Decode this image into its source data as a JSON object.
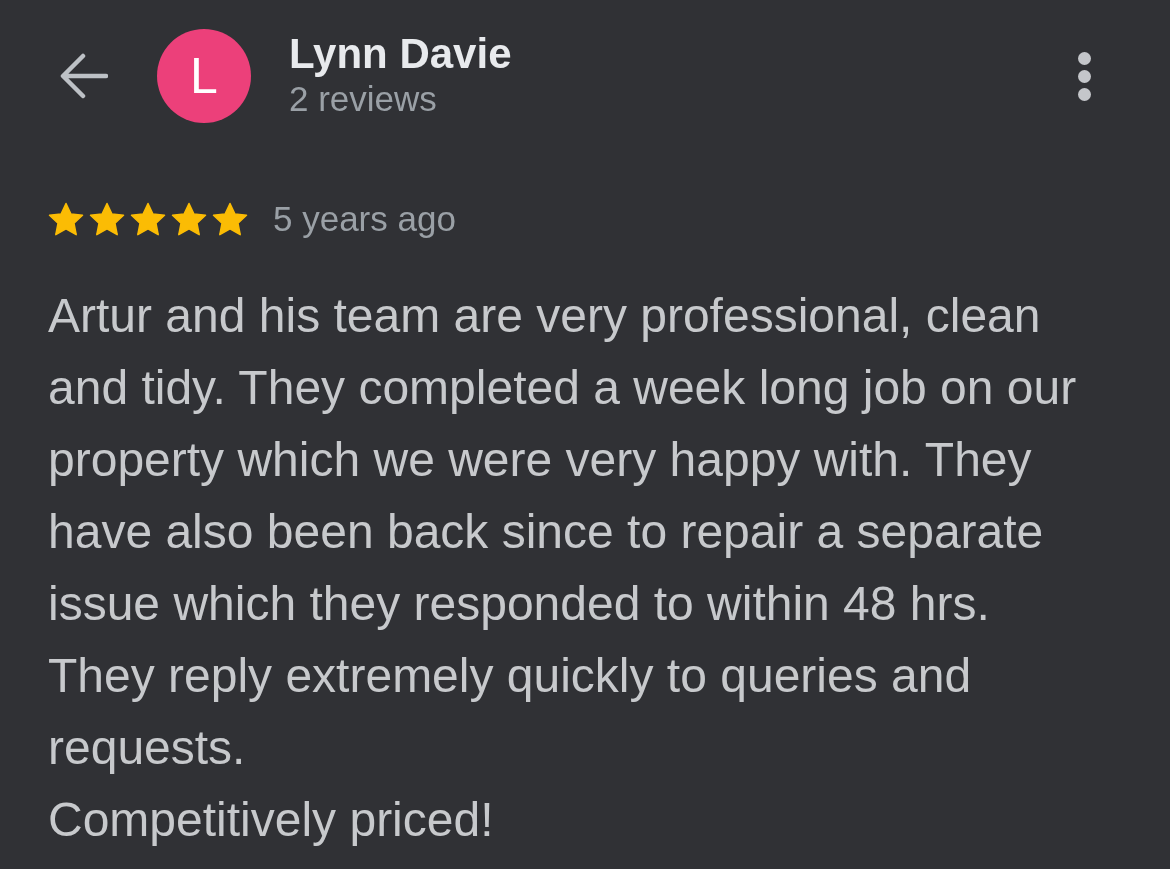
{
  "reviewer": {
    "avatar_letter": "L",
    "name": "Lynn Davie",
    "review_count": "2 reviews"
  },
  "review": {
    "stars": 5,
    "time": "5 years ago",
    "text": "Artur and his team are very professional, clean and tidy. They completed a week long job on our property which we were very happy with. They have also been back since to repair a separate issue which they responded to within 48 hrs.\nThey reply extremely quickly to queries and requests.\nCompetitively priced!"
  }
}
